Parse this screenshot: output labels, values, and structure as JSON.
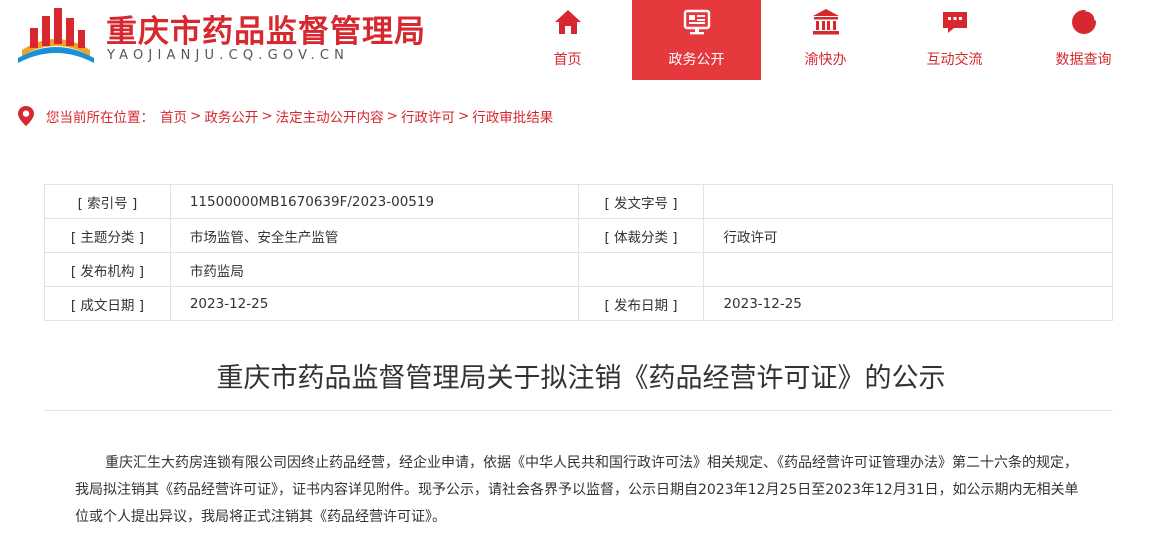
{
  "header": {
    "site_title": "重庆市药品监督管理局",
    "site_domain": "YAOJIANJU.CQ.GOV.CN",
    "brand_color": "#d7282f",
    "active_color": "#e5393d"
  },
  "nav": {
    "items": [
      {
        "label": "首页",
        "icon": "home-icon"
      },
      {
        "label": "政务公开",
        "icon": "monitor-icon",
        "active": true
      },
      {
        "label": "渝快办",
        "icon": "government-building-icon"
      },
      {
        "label": "互动交流",
        "icon": "chat-bubble-icon"
      },
      {
        "label": "数据查询",
        "icon": "pie-chart-icon"
      }
    ]
  },
  "breadcrumb": {
    "prefix": "您当前所在位置：",
    "items": [
      "首页",
      "政务公开",
      "法定主动公开内容",
      "行政许可",
      "行政审批结果"
    ],
    "separator": ">"
  },
  "meta": {
    "index_label": "[ 索引号 ]",
    "index_value": "11500000MB1670639F/2023-00519",
    "doc_no_label": "[ 发文字号 ]",
    "doc_no_value": "",
    "topic_label": "[ 主题分类 ]",
    "topic_value": "市场监管、安全生产监管",
    "genre_label": "[ 体裁分类 ]",
    "genre_value": "行政许可",
    "issuer_label": "[ 发布机构 ]",
    "issuer_value": "市药监局",
    "created_label": "[ 成文日期 ]",
    "created_value": "2023-12-25",
    "published_label": "[ 发布日期 ]",
    "published_value": "2023-12-25"
  },
  "article": {
    "title": "重庆市药品监督管理局关于拟注销《药品经营许可证》的公示",
    "body": "重庆汇生大药房连锁有限公司因终止药品经营，经企业申请，依据《中华人民共和国行政许可法》相关规定、《药品经营许可证管理办法》第二十六条的规定，我局拟注销其《药品经营许可证》，证书内容详见附件。现予公示，请社会各界予以监督，公示日期自2023年12月25日至2023年12月31日，如公示期内无相关单位或个人提出异议，我局将正式注销其《药品经营许可证》。"
  }
}
